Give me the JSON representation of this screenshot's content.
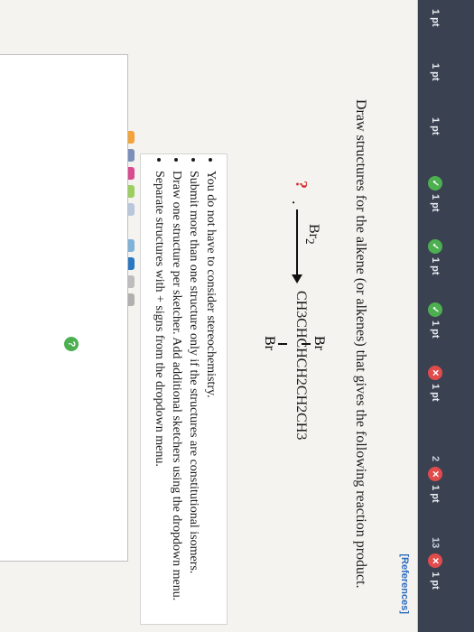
{
  "nav": {
    "items": [
      {
        "pts": "1 pt",
        "status": "none",
        "num": ""
      },
      {
        "pts": "1 pt",
        "status": "none",
        "num": ""
      },
      {
        "pts": "1 pt",
        "status": "none",
        "num": ""
      },
      {
        "pts": "1 pt",
        "status": "ok",
        "num": ""
      },
      {
        "pts": "1 pt",
        "status": "ok",
        "num": ""
      },
      {
        "pts": "1 pt",
        "status": "ok",
        "num": ""
      },
      {
        "pts": "1 pt",
        "status": "bad",
        "num": ""
      },
      {
        "pts": "1 pt",
        "status": "bad",
        "num": "2"
      },
      {
        "pts": "1 pt",
        "status": "bad",
        "num": "13"
      }
    ]
  },
  "panel": {
    "reference_label": "[References]",
    "prompt": "Draw structures for the alkene (or alkenes) that gives the following reaction product.",
    "reaction": {
      "question_mark": "?",
      "dot": ".",
      "reagent": "Br",
      "reagent_sub": "2",
      "product": "CH3CHCHCH2CH2CH3",
      "br_top": "Br",
      "br_bottom": "Br"
    },
    "instructions": [
      "You do not have to consider stereochemistry.",
      "Submit more than one structure only if the structures are constitutional isomers.",
      "Draw one structure per sketcher. Add additional sketchers using the dropdown menu.",
      "Separate structures with + signs from the dropdown menu."
    ],
    "help_label": "?"
  }
}
